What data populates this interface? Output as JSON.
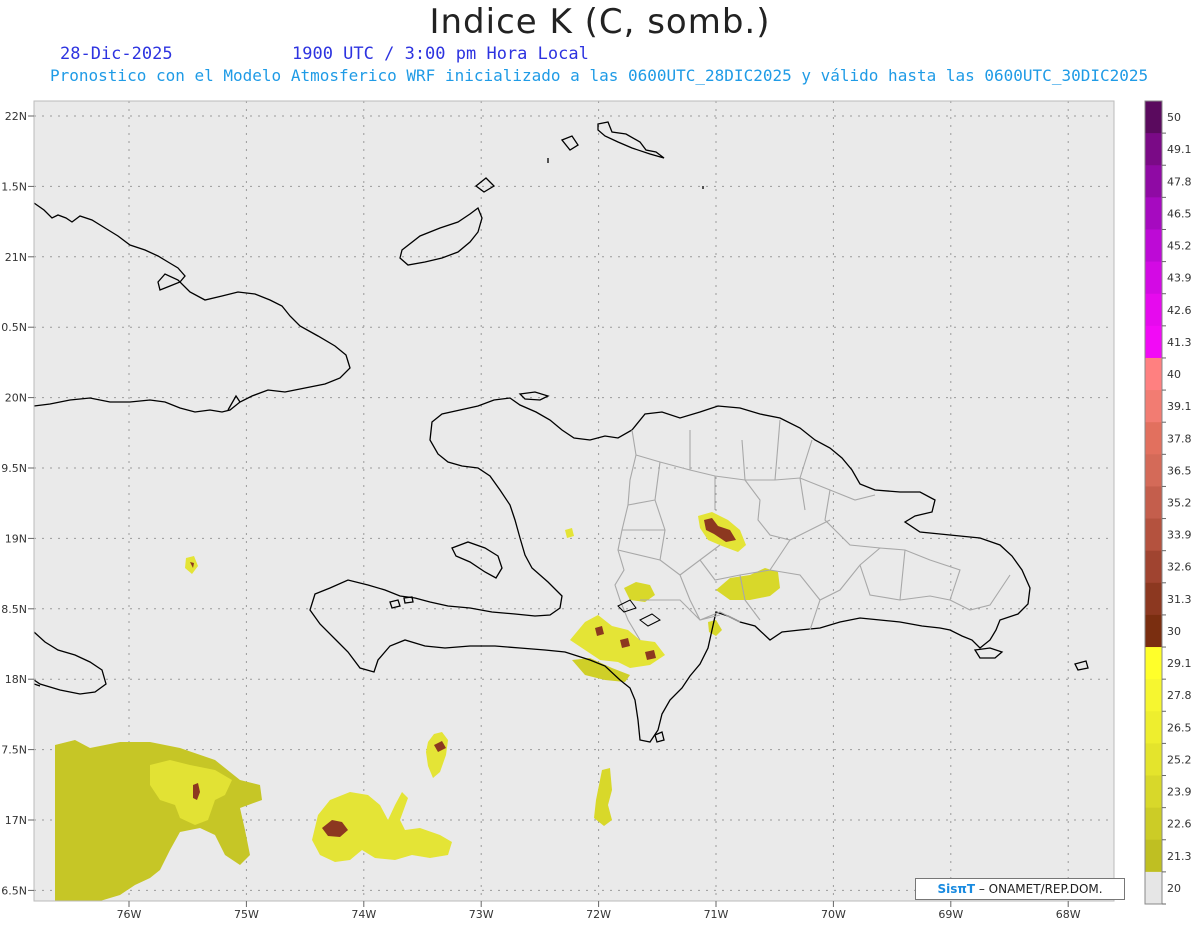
{
  "header": {
    "title": "Indice K (C, somb.)",
    "date": "28-Dic-2025",
    "time": "1900 UTC / 3:00 pm Hora Local",
    "subtitle": "Pronostico con el Modelo Atmosferico WRF inicializado a las 0600UTC_28DIC2025 y válido hasta las  0600UTC_30DIC2025"
  },
  "axes": {
    "lat_labels": [
      "22N",
      "1.5N",
      "21N",
      "0.5N",
      "20N",
      "9.5N",
      "19N",
      "8.5N",
      "18N",
      "7.5N",
      "17N",
      "6.5N"
    ],
    "lon_labels": [
      "76W",
      "75W",
      "74W",
      "73W",
      "72W",
      "71W",
      "70W",
      "69W",
      "68W"
    ]
  },
  "colorbar": {
    "labels": [
      "50",
      "49.1",
      "47.8",
      "46.5",
      "45.2",
      "43.9",
      "42.6",
      "41.3",
      "40",
      "39.1",
      "37.8",
      "36.5",
      "35.2",
      "33.9",
      "32.6",
      "31.3",
      "30",
      "29.1",
      "27.8",
      "26.5",
      "25.2",
      "23.9",
      "22.6",
      "21.3",
      "20"
    ],
    "colors": [
      "#5a0a5e",
      "#7a0a86",
      "#8f0aa4",
      "#a60ac0",
      "#bd0ad6",
      "#d30ae4",
      "#e60aee",
      "#f20af6",
      "#ff8080",
      "#f27c72",
      "#e2705e",
      "#d46a58",
      "#c45e4c",
      "#b4523e",
      "#a04430",
      "#8c3820",
      "#7a2e10",
      "#ffff2a",
      "#f6f630",
      "#eeee2e",
      "#e4e42c",
      "#d8d82a",
      "#cccc26",
      "#bfbf22",
      "#e6e6e6"
    ]
  },
  "credit": {
    "logo": "SisπΤ",
    "text": "– ONAMET/REP.DOM."
  },
  "legend_colors": {
    "map_bg": "#eaeaea",
    "coast": "#000000",
    "borders": "#a8a8a8",
    "k20": "#c6c626",
    "k26": "#e8e83a",
    "k30": "#ffff2a",
    "k31": "#8c3820"
  }
}
